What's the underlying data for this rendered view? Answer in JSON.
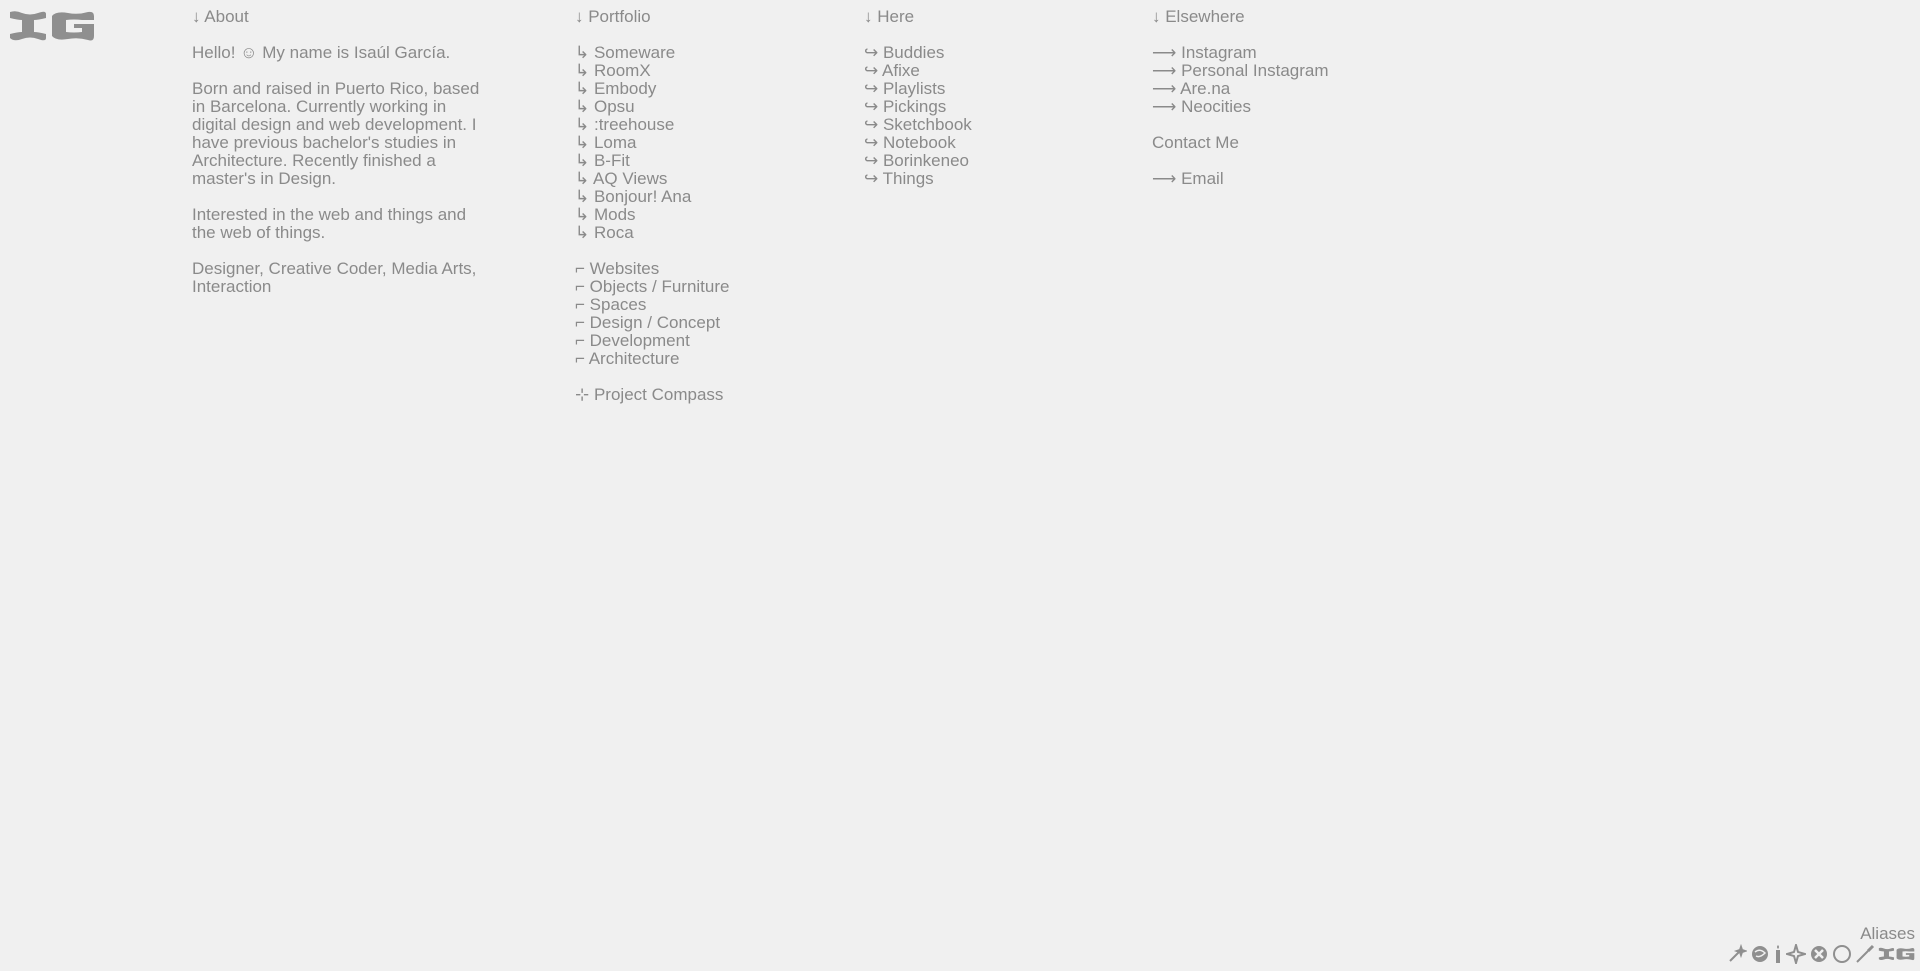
{
  "logo": {
    "icon": "ig-monogram-logo",
    "alt": "IG"
  },
  "about": {
    "heading": "↓ About",
    "paragraphs": [
      "Hello! ☺ My name is Isaúl García.",
      "Born and raised in Puerto Rico, based in Barcelona. Currently working in digital design and web development. I have previous bachelor's studies in Architecture. Recently finished a master's in Design.",
      "Interested in the web and things and the web of things.",
      "Designer, Creative Coder, Media Arts, Interaction"
    ]
  },
  "portfolio": {
    "heading": "↓ Portfolio",
    "projects": [
      "↳ Someware",
      "↳ RoomX",
      "↳ Embody",
      "↳ Opsu",
      "↳ :treehouse",
      "↳ Loma",
      "↳ B-Fit",
      "↳ AQ Views",
      "↳ Bonjour! Ana",
      "↳ Mods",
      "↳ Roca"
    ],
    "categories": [
      "⌐ Websites",
      "⌐ Objects / Furniture",
      "⌐ Spaces",
      "⌐ Design / Concept",
      "⌐ Development",
      "⌐ Architecture"
    ],
    "compass": "⊹ Project Compass"
  },
  "here": {
    "heading": "↓ Here",
    "items": [
      "↪ Buddies",
      "↪ Afixe",
      "↪ Playlists",
      "↪ Pickings",
      "↪ Sketchbook",
      "↪ Notebook",
      "↪ Borinkeneo",
      "↪ Things"
    ]
  },
  "elsewhere": {
    "heading": "↓ Elsewhere",
    "links": [
      "⟶ Instagram",
      "⟶ Personal Instagram",
      "⟶ Are.na",
      "⟶ Neocities"
    ],
    "contact_heading": "Contact Me",
    "contact_links": [
      "⟶ Email"
    ]
  },
  "aliases": {
    "label": "Aliases",
    "icons": [
      "sparkle-pen-icon",
      "scribble-circle-icon",
      "candle-icon",
      "four-point-star-icon",
      "x-circle-icon",
      "ring-icon",
      "brush-icon",
      "ig-small-logo-icon"
    ]
  },
  "colors": {
    "background": "#f0f0f0",
    "text": "#8a8a8a",
    "logo": "#8f8f8f"
  }
}
